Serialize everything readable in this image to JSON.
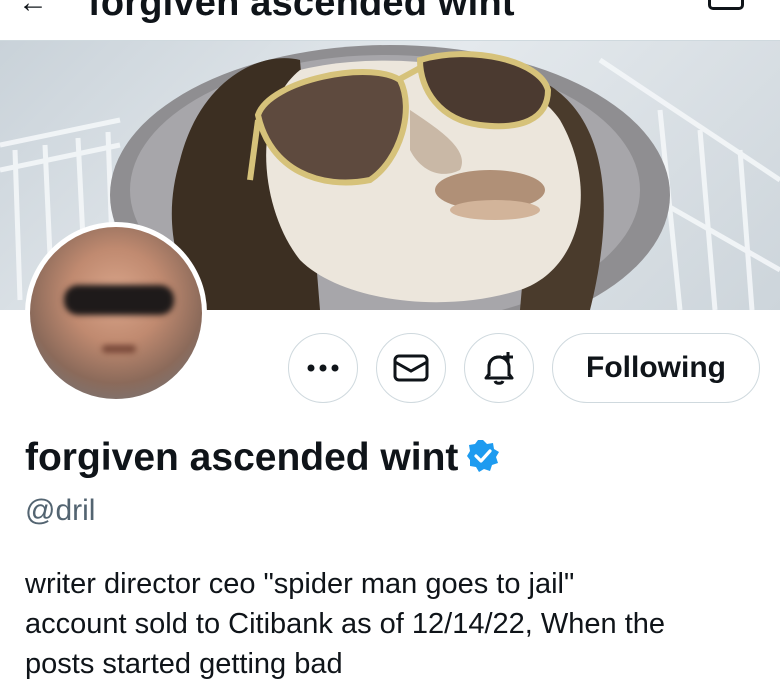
{
  "header": {
    "title": "forgiven ascended wint"
  },
  "profile": {
    "display_name": "forgiven ascended wint",
    "handle": "@dril",
    "bio_lines": [
      "writer director ceo \"spider man goes to jail\"",
      "account sold to Citibank as of 12/14/22, When the",
      "posts started getting bad"
    ]
  },
  "actions": {
    "follow_label": "Following"
  },
  "icons": {
    "back": "arrow-left-icon",
    "more": "more-horizontal-icon",
    "message": "envelope-icon",
    "notify": "bell-plus-icon",
    "verified": "verified-badge-icon"
  },
  "colors": {
    "verified_blue": "#1d9bf0",
    "text_primary": "#0f1419",
    "text_secondary": "#536471",
    "border": "#cfd9de"
  }
}
